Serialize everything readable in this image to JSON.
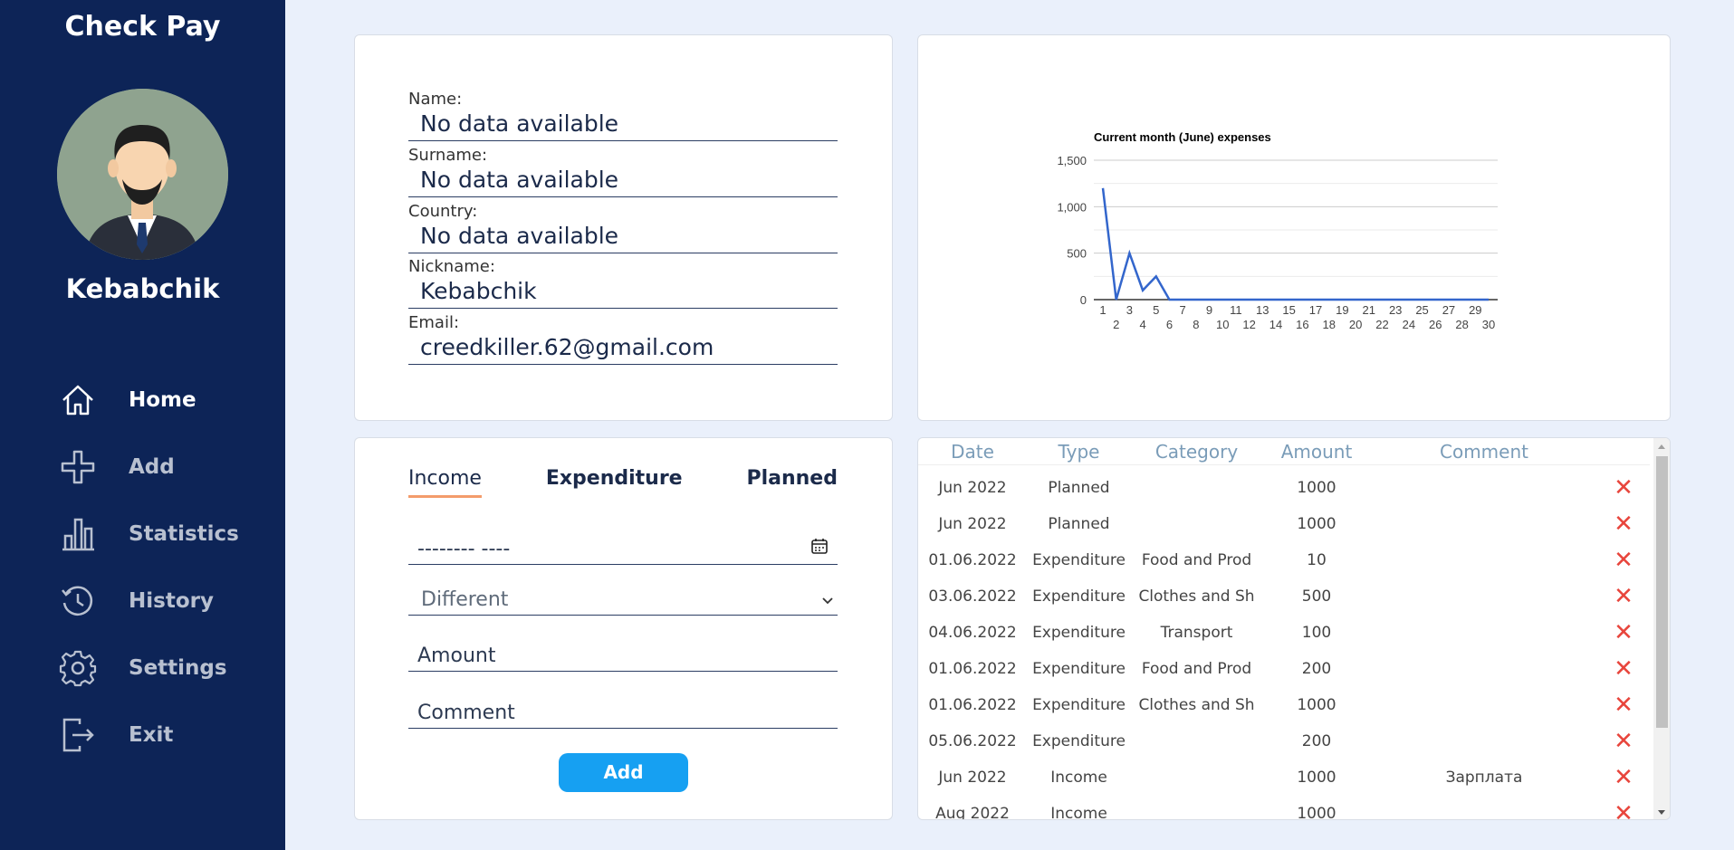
{
  "app": {
    "title": "Check Pay"
  },
  "user": {
    "name": "Kebabchik"
  },
  "nav": [
    {
      "label": "Home",
      "icon": "home-icon",
      "active": true
    },
    {
      "label": "Add",
      "icon": "plus-icon"
    },
    {
      "label": "Statistics",
      "icon": "bar-chart-icon"
    },
    {
      "label": "History",
      "icon": "history-icon"
    },
    {
      "label": "Settings",
      "icon": "gear-icon"
    },
    {
      "label": "Exit",
      "icon": "exit-icon"
    }
  ],
  "profile": {
    "name_label": "Name:",
    "name_value": "No data available",
    "surname_label": "Surname:",
    "surname_value": "No data available",
    "country_label": "Country:",
    "country_value": "No data available",
    "nickname_label": "Nickname:",
    "nickname_value": "Kebabchik",
    "email_label": "Email:",
    "email_value": "creedkiller.62@gmail.com"
  },
  "form": {
    "tabs": [
      "Income",
      "Expenditure",
      "Planned"
    ],
    "active_tab": "Income",
    "date_placeholder": "-------- ----",
    "category_value": "Different",
    "amount_placeholder": "Amount",
    "comment_placeholder": "Comment",
    "add_label": "Add"
  },
  "table": {
    "headers": [
      "Date",
      "Type",
      "Category",
      "Amount",
      "Comment"
    ],
    "rows": [
      [
        "Jun 2022",
        "Planned",
        "",
        "1000",
        ""
      ],
      [
        "Jun 2022",
        "Planned",
        "",
        "1000",
        ""
      ],
      [
        "01.06.2022",
        "Expenditure",
        "Food and Prod",
        "10",
        ""
      ],
      [
        "03.06.2022",
        "Expenditure",
        "Clothes and Sh",
        "500",
        ""
      ],
      [
        "04.06.2022",
        "Expenditure",
        "Transport",
        "100",
        ""
      ],
      [
        "01.06.2022",
        "Expenditure",
        "Food and Prod",
        "200",
        ""
      ],
      [
        "01.06.2022",
        "Expenditure",
        "Clothes and Sh",
        "1000",
        ""
      ],
      [
        "05.06.2022",
        "Expenditure",
        "",
        "200",
        ""
      ],
      [
        "Jun 2022",
        "Income",
        "",
        "1000",
        "Зарплата"
      ],
      [
        "Aug 2022",
        "Income",
        "",
        "1000",
        ""
      ]
    ],
    "delete_icon": "close-icon",
    "delete_glyph": "✕"
  },
  "chart_data": {
    "type": "line",
    "title": "Current month (June) expenses",
    "x": [
      1,
      2,
      3,
      4,
      5,
      6,
      7,
      8,
      9,
      10,
      11,
      12,
      13,
      14,
      15,
      16,
      17,
      18,
      19,
      20,
      21,
      22,
      23,
      24,
      25,
      26,
      27,
      28,
      29,
      30
    ],
    "series": [
      {
        "values": [
          1200,
          0,
          500,
          100,
          250,
          0,
          0,
          0,
          0,
          0,
          0,
          0,
          0,
          0,
          0,
          0,
          0,
          0,
          0,
          0,
          0,
          0,
          0,
          0,
          0,
          0,
          0,
          0,
          0,
          0
        ]
      }
    ],
    "xticks_top": [
      "1",
      "3",
      "5",
      "7",
      "9",
      "11",
      "13",
      "15",
      "17",
      "19",
      "21",
      "23",
      "25",
      "27",
      "29"
    ],
    "xticks_bottom": [
      "2",
      "4",
      "6",
      "8",
      "10",
      "12",
      "14",
      "16",
      "18",
      "20",
      "22",
      "24",
      "26",
      "28",
      "30"
    ],
    "yticks": [
      "0",
      "500",
      "1,000",
      "1,500"
    ],
    "ylim": [
      0,
      1500
    ],
    "grid": true,
    "line_color": "#3366cc"
  }
}
